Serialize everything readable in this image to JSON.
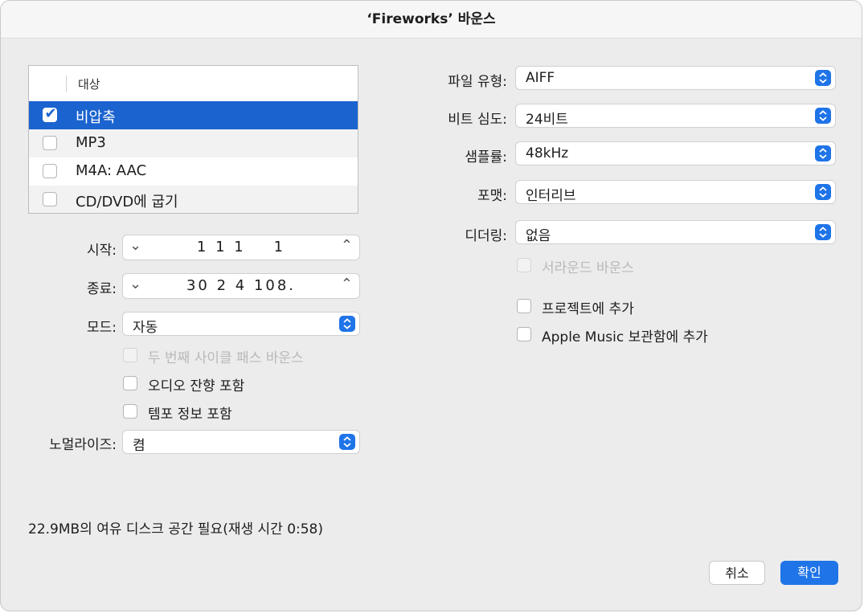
{
  "window": {
    "title": "‘Fireworks’ 바운스"
  },
  "destinations": {
    "header": "대상",
    "items": [
      {
        "label": "비압축",
        "checked": true
      },
      {
        "label": "MP3",
        "checked": false
      },
      {
        "label": "M4A: AAC",
        "checked": false
      },
      {
        "label": "CD/DVD에 굽기",
        "checked": false
      }
    ]
  },
  "range": {
    "start_label": "시작:",
    "start_value": "1 1 1    1",
    "end_label": "종료:",
    "end_value": "30 2 4 108."
  },
  "mode": {
    "label": "모드:",
    "value": "자동"
  },
  "left_options": [
    {
      "label": "두 번째 사이클 패스 바운스",
      "checked": false,
      "disabled": true
    },
    {
      "label": "오디오 잔향 포함",
      "checked": false,
      "disabled": false
    },
    {
      "label": "템포 정보 포함",
      "checked": false,
      "disabled": false
    }
  ],
  "normalize": {
    "label": "노멀라이즈:",
    "value": "켬"
  },
  "format": {
    "file_type_label": "파일 유형:",
    "file_type": "AIFF",
    "bit_depth_label": "비트 심도:",
    "bit_depth": "24비트",
    "sample_rate_label": "샘플률:",
    "sample_rate": "48kHz",
    "format_label": "포맷:",
    "format": "인터리브",
    "dither_label": "디더링:",
    "dither": "없음"
  },
  "right_options": [
    {
      "label": "서라운드 바운스",
      "checked": false,
      "disabled": true
    },
    {
      "label": "프로젝트에 추가",
      "checked": false,
      "disabled": false
    },
    {
      "label": "Apple Music 보관함에 추가",
      "checked": false,
      "disabled": false
    }
  ],
  "footer": {
    "disk_space": "22.9MB의 여유 디스크 공간 필요(재생 시간 0:58)"
  },
  "buttons": {
    "cancel": "취소",
    "ok": "확인"
  },
  "colors": {
    "accent": "#1f74e8",
    "selection": "#1b63cf"
  }
}
